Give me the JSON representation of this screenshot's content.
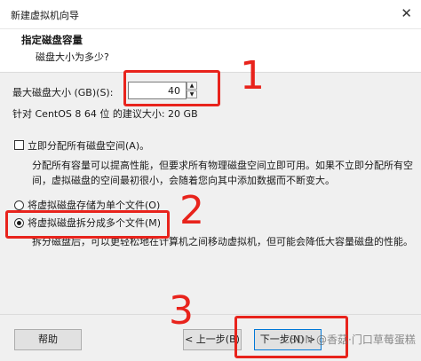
{
  "window": {
    "title": "新建虚拟机向导",
    "close_glyph": "✕"
  },
  "header": {
    "title": "指定磁盘容量",
    "subtitle": "磁盘大小为多少?"
  },
  "disk_size": {
    "label": "最大磁盘大小 (GB)(S):",
    "value": "40",
    "recommend": "针对 CentOS 8 64 位 的建议大小: 20 GB"
  },
  "allocate": {
    "label": "立即分配所有磁盘空间(A)。",
    "checked": false,
    "description": "分配所有容量可以提高性能，但要求所有物理磁盘空间立即可用。如果不立即分配所有空间，虚拟磁盘的空间最初很小，会随着您向其中添加数据而不断变大。"
  },
  "storage": {
    "single": {
      "label": "将虚拟磁盘存储为单个文件(O)",
      "selected": false
    },
    "split": {
      "label": "将虚拟磁盘拆分成多个文件(M)",
      "selected": true
    },
    "description": "拆分磁盘后，可以更轻松地在计算机之间移动虚拟机，但可能会降低大容量磁盘的性能。"
  },
  "footer": {
    "help": "帮助",
    "prev": "< 上一步(B)",
    "next": "下一步(N) >"
  },
  "annotations": {
    "one": "1",
    "two": "2",
    "three": "3",
    "color": "#e8231c"
  },
  "watermark": "CSDN @香菇·门口草莓蛋糕"
}
